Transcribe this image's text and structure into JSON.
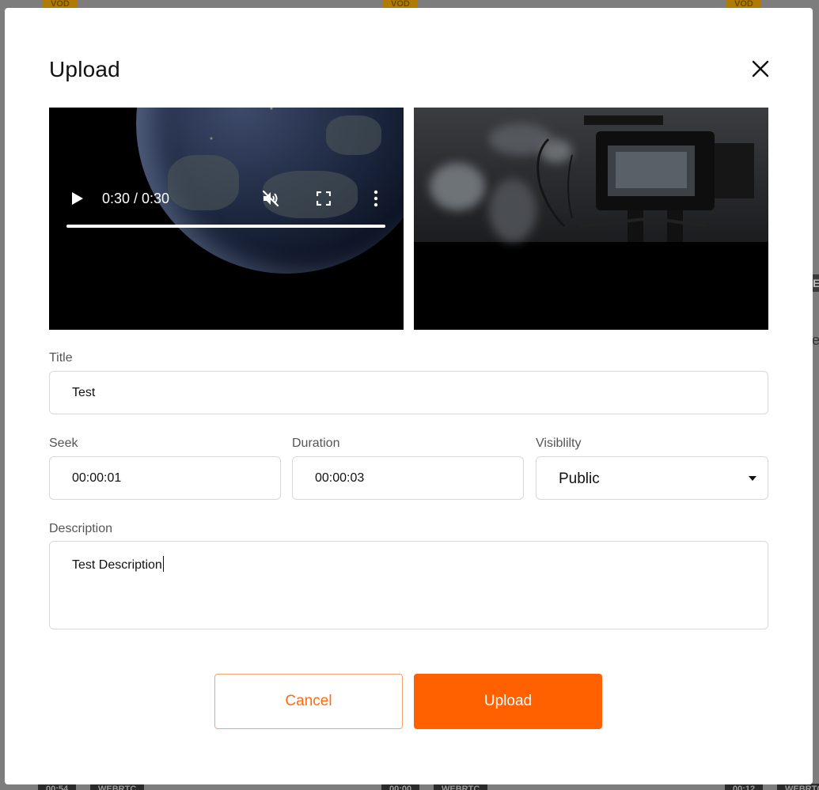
{
  "background": {
    "top_badges": [
      "VOD",
      "VOD",
      "VOD"
    ],
    "bottom_items": [
      {
        "time": "00:54",
        "tag": "WEBRTC"
      },
      {
        "time": "00:00",
        "tag": "WEBRTC"
      },
      {
        "time": "00:12",
        "tag": "WEBRTC"
      }
    ],
    "fragments": [
      "E",
      "e"
    ]
  },
  "modal": {
    "title": "Upload",
    "close_icon": "close-icon"
  },
  "video_player": {
    "time_display": "0:30 / 0:30",
    "progress_percent": 100,
    "icons": [
      "play-icon",
      "muted-icon",
      "fullscreen-icon",
      "more-vertical-icon"
    ]
  },
  "form": {
    "title": {
      "label": "Title",
      "value": "Test"
    },
    "seek": {
      "label": "Seek",
      "value": "00:00:01"
    },
    "duration": {
      "label": "Duration",
      "value": "00:00:03"
    },
    "visibility": {
      "label": "Visiblilty",
      "value": "Public"
    },
    "description": {
      "label": "Description",
      "value": "Test Description"
    }
  },
  "buttons": {
    "cancel": "Cancel",
    "upload": "Upload"
  },
  "colors": {
    "accent": "#ff6000",
    "cancel_border": "#f4a36f",
    "cancel_text": "#ff6a13"
  }
}
